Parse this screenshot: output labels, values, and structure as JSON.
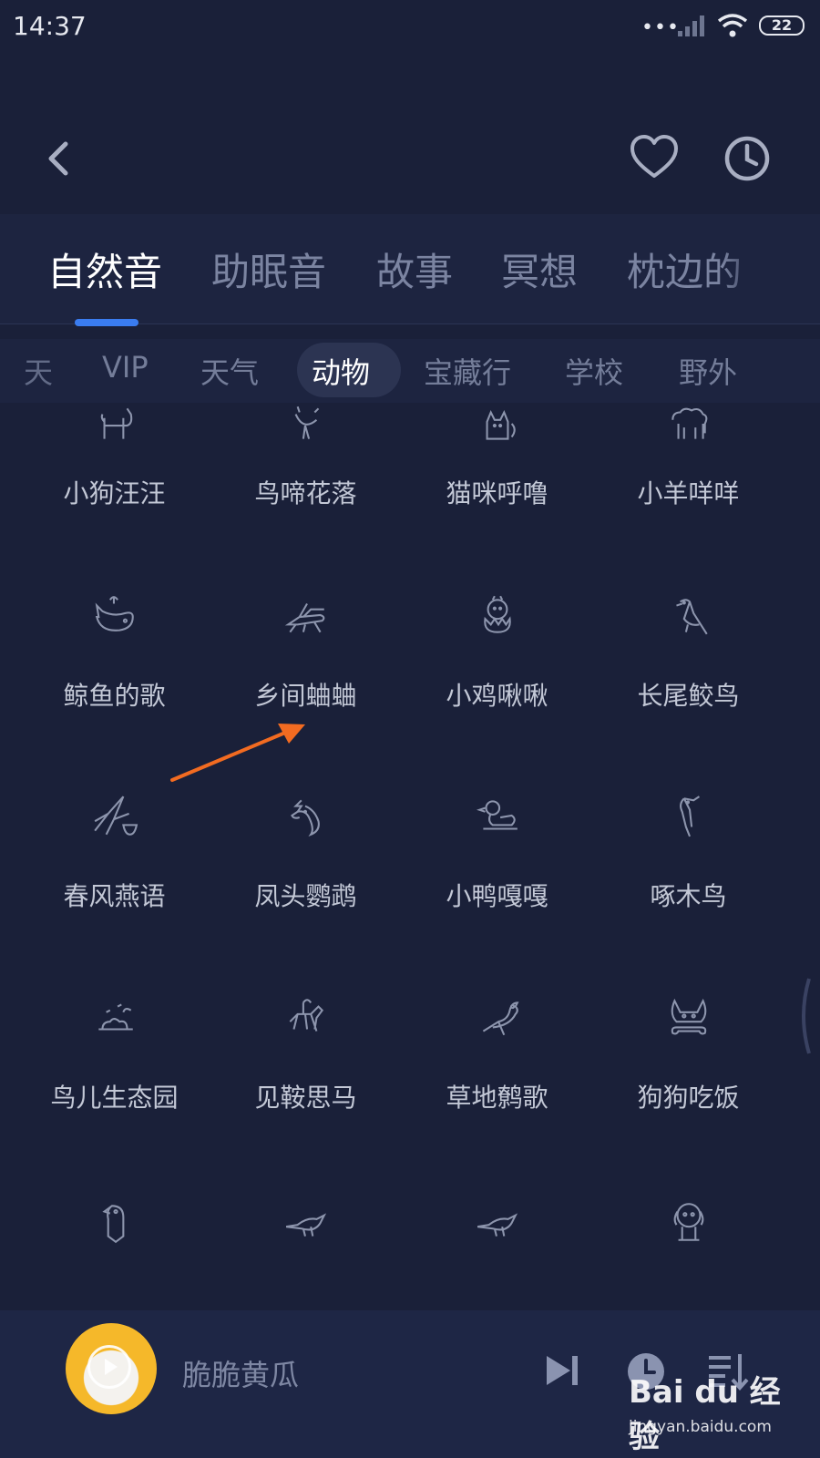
{
  "status_bar": {
    "time": "14:37",
    "dots": "•••",
    "battery": "22"
  },
  "main_tabs": [
    {
      "label": "自然音",
      "active": true
    },
    {
      "label": "助眠音",
      "active": false
    },
    {
      "label": "故事",
      "active": false
    },
    {
      "label": "冥想",
      "active": false
    },
    {
      "label": "枕边的",
      "active": false
    }
  ],
  "sub_tabs": [
    {
      "label": "天",
      "active": false
    },
    {
      "label": "VIP",
      "active": false
    },
    {
      "label": "天气",
      "active": false
    },
    {
      "label": "动物",
      "active": true
    },
    {
      "label": "宝藏行",
      "active": false
    },
    {
      "label": "学校",
      "active": false
    },
    {
      "label": "野外",
      "active": false
    }
  ],
  "sounds": [
    {
      "label": "小狗汪汪",
      "icon": "dog-icon"
    },
    {
      "label": "鸟啼花落",
      "icon": "bird-icon"
    },
    {
      "label": "猫咪呼噜",
      "icon": "cat-icon"
    },
    {
      "label": "小羊咩咩",
      "icon": "sheep-icon"
    },
    {
      "label": "鲸鱼的歌",
      "icon": "whale-icon"
    },
    {
      "label": "乡间蛐蛐",
      "icon": "cricket-icon"
    },
    {
      "label": "小鸡啾啾",
      "icon": "chick-icon"
    },
    {
      "label": "长尾鲛鸟",
      "icon": "magpie-icon"
    },
    {
      "label": "春风燕语",
      "icon": "swallow-icon"
    },
    {
      "label": "凤头鹦鹉",
      "icon": "cockatoo-icon"
    },
    {
      "label": "小鸭嘎嘎",
      "icon": "duck-icon"
    },
    {
      "label": "啄木鸟",
      "icon": "woodpecker-icon"
    },
    {
      "label": "鸟儿生态园",
      "icon": "bird-park-icon"
    },
    {
      "label": "见鞍思马",
      "icon": "horse-rider-icon"
    },
    {
      "label": "草地鹩歌",
      "icon": "crow-icon"
    },
    {
      "label": "狗狗吃饭",
      "icon": "dog-bone-icon"
    },
    {
      "label": "",
      "icon": "parrot-icon"
    },
    {
      "label": "",
      "icon": "sparrow-icon"
    },
    {
      "label": "",
      "icon": "sparrow-icon"
    },
    {
      "label": "",
      "icon": "puppy-icon"
    }
  ],
  "player": {
    "track_title": "脆脆黄瓜"
  },
  "watermark": {
    "logo": "Bai du 经验",
    "url": "jingyan.baidu.com"
  },
  "colors": {
    "background": "#1a2039",
    "accent": "#3a7cf0",
    "annotation_arrow": "#f26b21"
  }
}
